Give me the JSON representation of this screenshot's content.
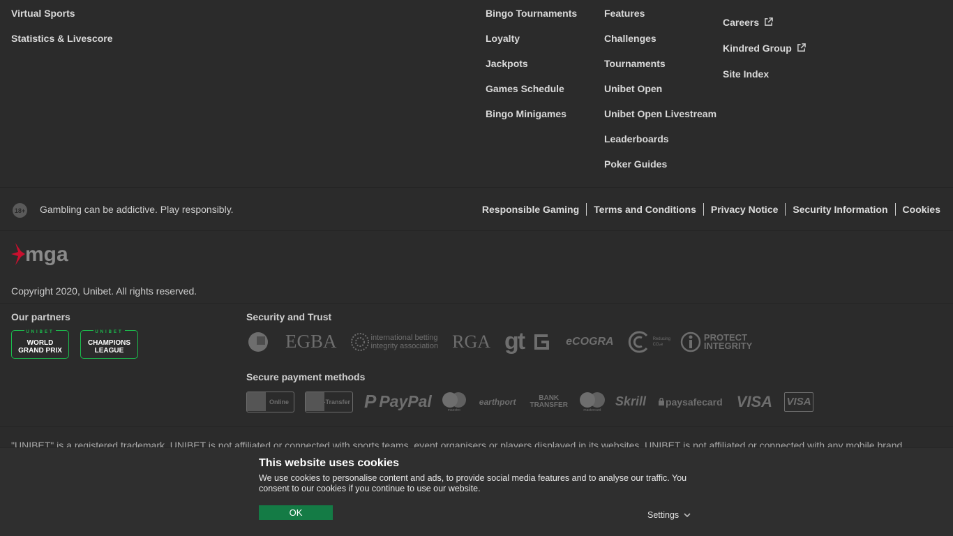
{
  "sports_col": [
    "Virtual Sports",
    "Statistics & Livescore"
  ],
  "bingo_col": [
    "Bingo Tournaments",
    "Loyalty",
    "Jackpots",
    "Games Schedule",
    "Bingo Minigames"
  ],
  "poker_col": [
    "Features",
    "Challenges",
    "Tournaments",
    "Unibet Open",
    "Unibet Open Livestream",
    "Leaderboards",
    "Poker Guides"
  ],
  "about_col": [
    "Careers",
    "Kindred Group",
    "Site Index"
  ],
  "rg": {
    "age": "18+",
    "text": "Gambling can be addictive. Play responsibly.",
    "links": [
      "Responsible Gaming",
      "Terms and Conditions",
      "Privacy Notice",
      "Security Information",
      "Cookies"
    ]
  },
  "regulator": "mga",
  "copyright": "Copyright 2020, Unibet. All rights reserved.",
  "partners": {
    "title": "Our partners",
    "items": [
      {
        "top": "UNIBET",
        "line1": "WORLD",
        "line2": "GRAND PRIX"
      },
      {
        "top": "UNIBET",
        "line1": "CHAMPIONS",
        "line2": "LEAGUE"
      }
    ]
  },
  "security": {
    "title": "Security and Trust",
    "logos": [
      "EGBA",
      "international betting",
      "integrity association",
      "RGA",
      "gt",
      "eCOGRA",
      "Reducing",
      "CO₂e",
      "PROTECT",
      "INTEGRITY"
    ]
  },
  "payments": {
    "title": "Secure payment methods",
    "logos": [
      "Online",
      "e-Transfer",
      "PayPal",
      "maestro",
      "earthport",
      "BANK",
      "TRANSFER",
      "mastercard",
      "Skrill",
      "paysafecard",
      "VISA",
      "VISA"
    ]
  },
  "disclaimer": "\"UNIBET\" is a registered trademark. UNIBET is not affiliated or connected with sports teams, event organisers or players displayed in its websites. UNIBET is not affiliated or connected with any mobile brand",
  "cookie": {
    "title": "This website uses cookies",
    "body": "We use cookies to personalise content and ads, to provide social media features and to analyse our traffic. You consent to our cookies if you continue to use our website.",
    "ok_label": "OK",
    "settings_label": "Settings"
  },
  "colors": {
    "background": "#2b2b2b",
    "partner_green": "#1bbd4d",
    "ok_green": "#147b45",
    "mga_red": "#c8102e"
  }
}
